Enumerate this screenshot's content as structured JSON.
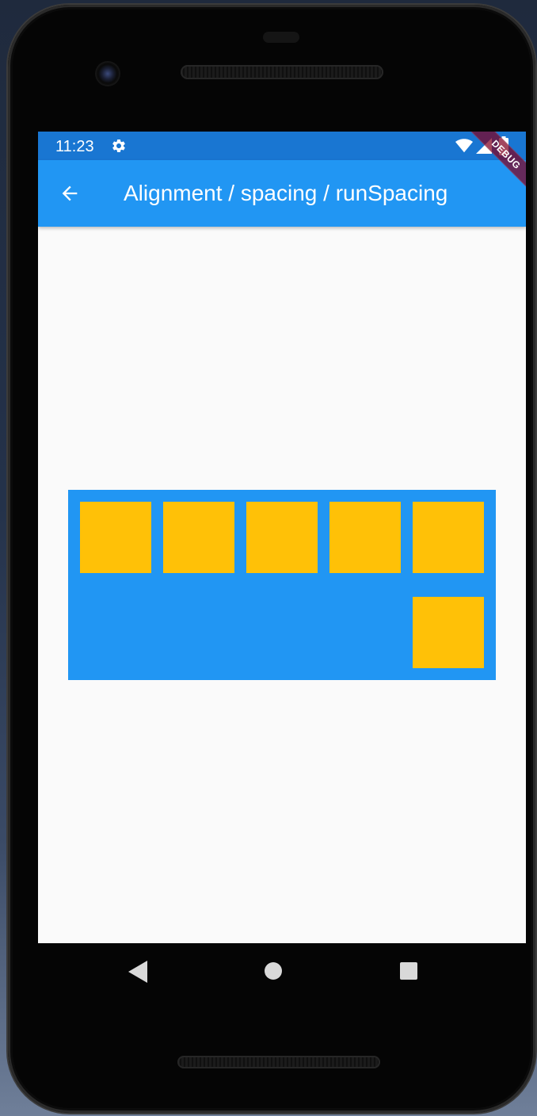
{
  "status_bar": {
    "time": "11:23",
    "icons": [
      "gear-icon",
      "wifi-icon",
      "signal-icon",
      "battery-icon"
    ]
  },
  "app_bar": {
    "title": "Alignment / spacing / runSpacing",
    "back_icon": "arrow-back-icon"
  },
  "debug_banner": {
    "label": "DEBUG"
  },
  "wrap_demo": {
    "box_count": 6,
    "container_color": "#2196f3",
    "box_color": "#ffc107"
  },
  "nav_bar": {
    "icons": [
      "nav-back-icon",
      "nav-home-icon",
      "nav-recents-icon"
    ]
  },
  "colors": {
    "status_bar": "#1976d2",
    "app_bar": "#2196f3",
    "screen_background": "#fafafa",
    "debug_banner": "#800020"
  }
}
